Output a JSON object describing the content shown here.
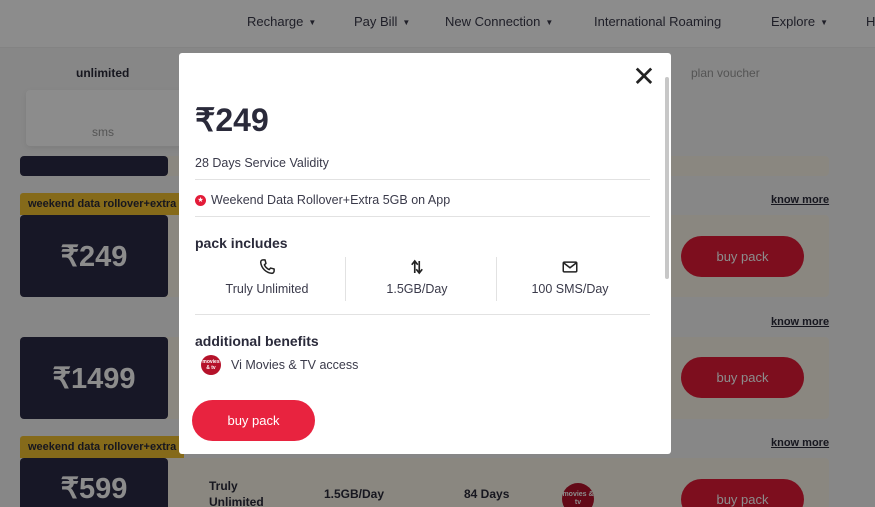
{
  "nav": {
    "items": [
      {
        "label": "Recharge",
        "caret": "▼"
      },
      {
        "label": "Pay Bill",
        "caret": "▼"
      },
      {
        "label": "New Connection",
        "caret": "▼"
      },
      {
        "label": "International Roaming",
        "caret": ""
      },
      {
        "label": "Explore",
        "caret": "▼"
      },
      {
        "label": "H",
        "caret": ""
      }
    ]
  },
  "filters": {
    "unlimited": "unlimited",
    "sms": "sms",
    "plan_voucher": "plan voucher"
  },
  "plans": [
    {
      "tag": "weekend data rollover+extra",
      "price": "₹249",
      "buy_label": "buy pack",
      "know_more": "know more"
    },
    {
      "tag": "",
      "price": "₹1499",
      "buy_label": "buy pack",
      "know_more": "know more"
    },
    {
      "tag": "weekend data rollover+extra",
      "price": "₹599",
      "buy_label": "buy pack",
      "know_more": "know more",
      "calls": "Truly Unlimited",
      "data": "1.5GB/Day",
      "validity": "84 Days",
      "badge": "movies & tv"
    }
  ],
  "modal": {
    "price": "₹249",
    "validity": "28 Days Service Validity",
    "benefit": "Weekend Data Rollover+Extra 5GB on App",
    "pack_includes_title": "pack includes",
    "includes": [
      {
        "icon": "phone-icon",
        "label": "Truly Unlimited"
      },
      {
        "icon": "data-arrows-icon",
        "label": "1.5GB/Day"
      },
      {
        "icon": "mail-icon",
        "label": "100 SMS/Day"
      }
    ],
    "additional_title": "additional benefits",
    "addon": {
      "logo_text": "movies & tv",
      "label": "Vi Movies & TV access"
    },
    "buy_label": "buy pack",
    "close_glyph": "✕"
  },
  "colors": {
    "brand_red": "#e8233f",
    "price_block": "#2b2b45",
    "tag_yellow": "#f2c230"
  }
}
